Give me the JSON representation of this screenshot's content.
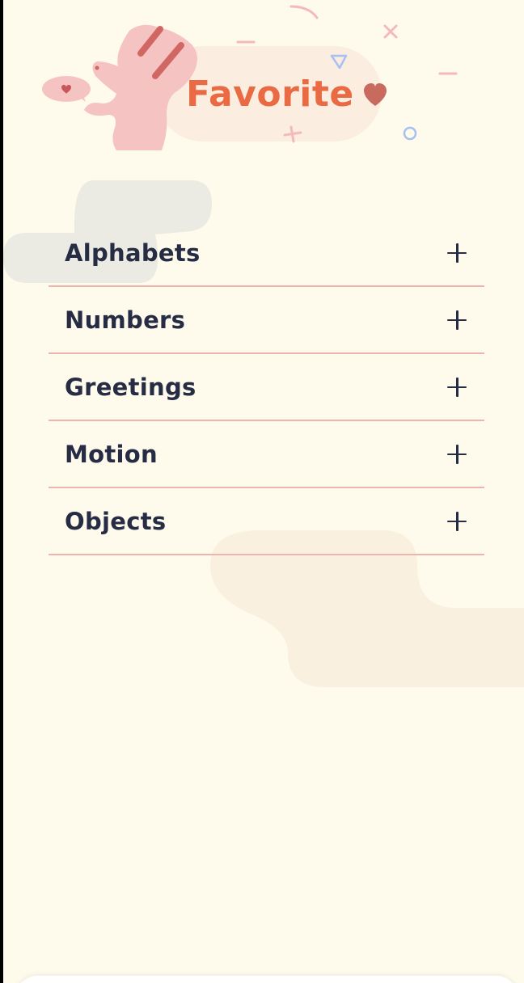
{
  "header": {
    "title": "Favorite",
    "title_color": "#ea6b43",
    "heart_color": "#c96a5f"
  },
  "categories": [
    {
      "label": "Alphabets",
      "icon": "plus-icon"
    },
    {
      "label": "Numbers",
      "icon": "plus-icon"
    },
    {
      "label": "Greetings",
      "icon": "plus-icon"
    },
    {
      "label": "Motion",
      "icon": "plus-icon"
    },
    {
      "label": "Objects",
      "icon": "plus-icon"
    }
  ],
  "colors": {
    "background": "#fefaec",
    "text": "#262c44",
    "divider": "#efb4ad",
    "mascot": "#f5c4c2",
    "accent": "#ea6b43"
  }
}
